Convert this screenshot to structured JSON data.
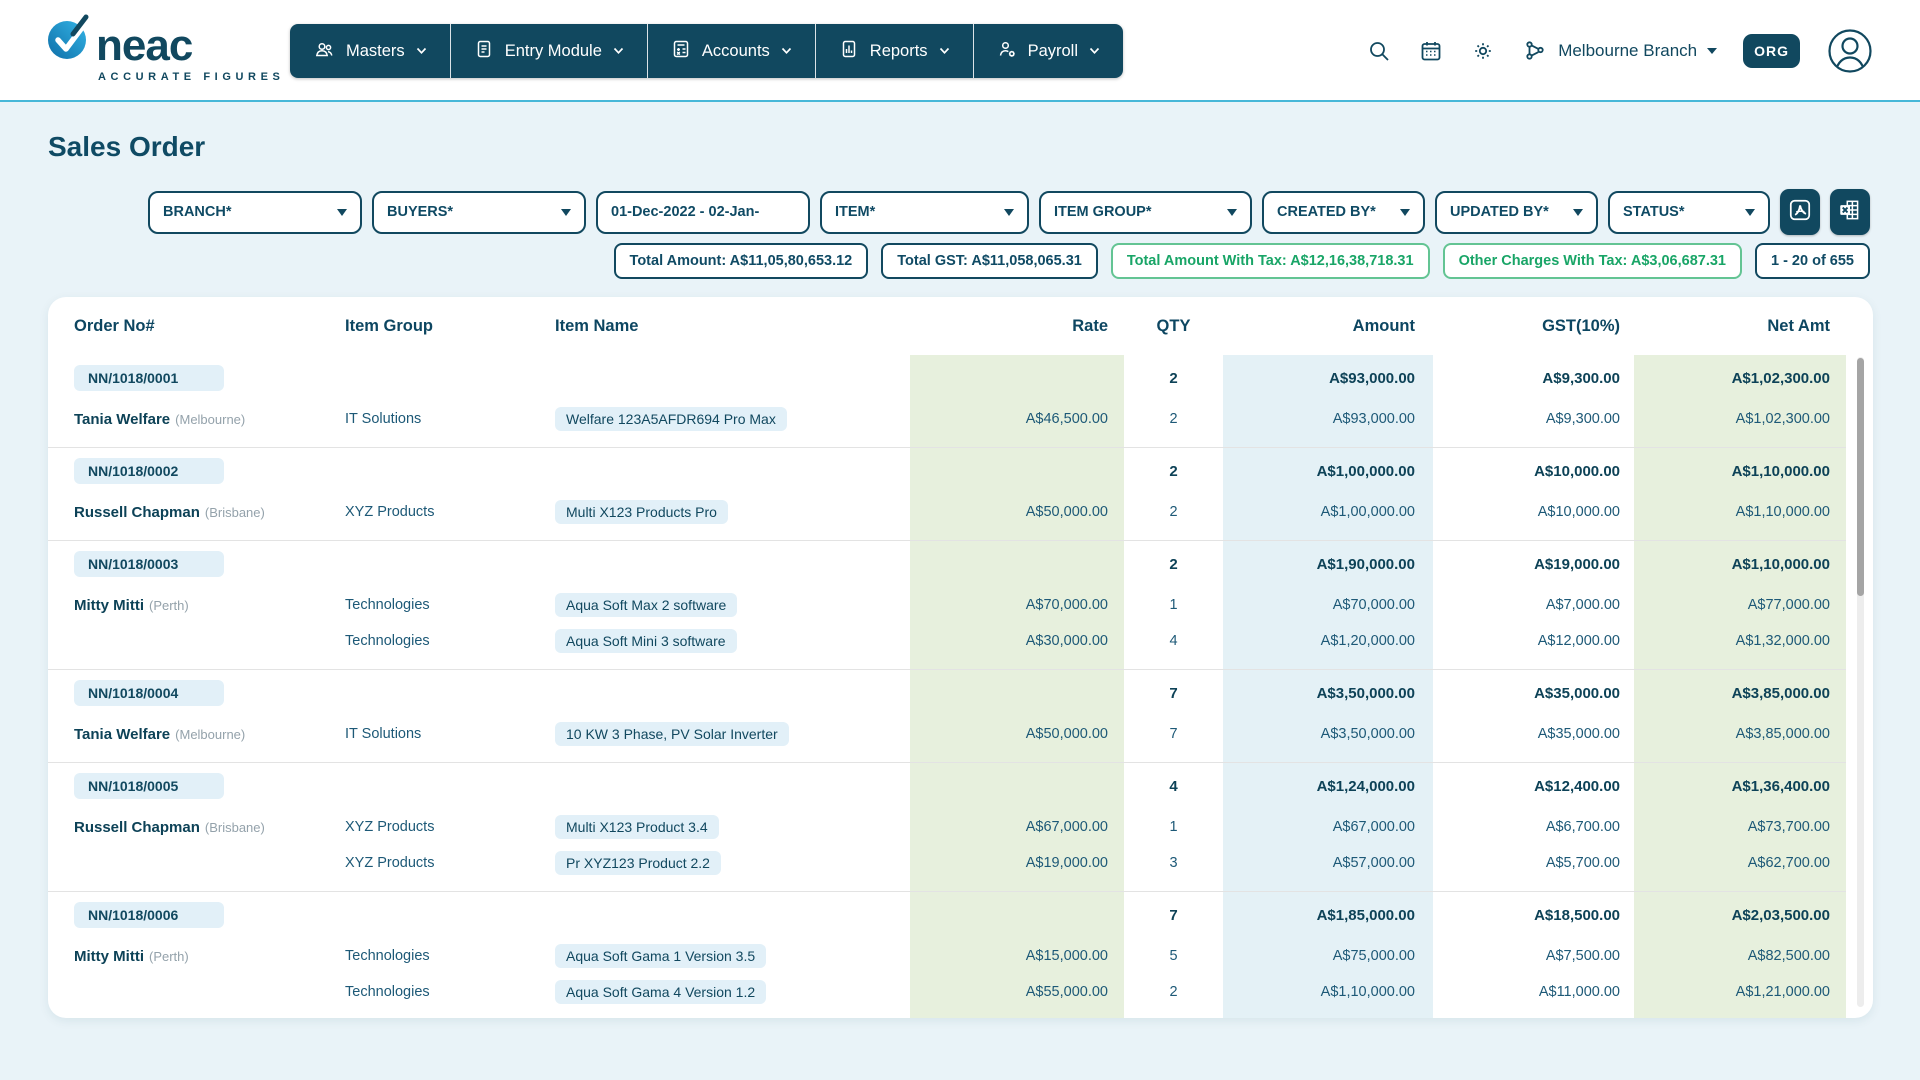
{
  "brand": {
    "name": "neac",
    "tagline": "ACCURATE FIGURES"
  },
  "nav": {
    "items": [
      {
        "label": "Masters",
        "icon": "people-icon"
      },
      {
        "label": "Entry Module",
        "icon": "document-icon"
      },
      {
        "label": "Accounts",
        "icon": "calculator-icon"
      },
      {
        "label": "Reports",
        "icon": "report-icon"
      },
      {
        "label": "Payroll",
        "icon": "payroll-gear-icon"
      }
    ]
  },
  "topbar": {
    "branch": "Melbourne Branch",
    "org_badge": "ORG",
    "icons": [
      "search-icon",
      "calendar-icon",
      "settings-gear-icon",
      "branch-hierarchy-icon",
      "user-avatar-icon"
    ]
  },
  "page_title": "Sales Order",
  "filters": {
    "branch": "BRANCH*",
    "buyers": "BUYERS*",
    "date_range": "01-Dec-2022 - 02-Jan-",
    "item": "ITEM*",
    "item_group": "ITEM GROUP*",
    "created_by": "CREATED BY*",
    "updated_by": "UPDATED BY*",
    "status": "STATUS*"
  },
  "export": {
    "pdf_icon": "pdf-export-icon",
    "excel_icon": "excel-export-icon"
  },
  "summary_badges": {
    "total_amount": "Total Amount: A$11,05,80,653.12",
    "total_gst": "Total GST: A$11,058,065.31",
    "total_with_tax": "Total Amount With Tax: A$12,16,38,718.31",
    "other_charges": "Other Charges With Tax: A$3,06,687.31",
    "pagination": "1 - 20 of 655"
  },
  "colors": {
    "navy": "#11485f",
    "cyan_accent": "#47b7d8",
    "green_text": "#19a567",
    "green_border": "#63c493",
    "band_green": "#e7f0dd",
    "band_blue": "#e4f1f6",
    "pill_blue": "#e2f0f8",
    "page_bg": "#e9f3f8"
  },
  "table": {
    "columns": [
      "Order No#",
      "Item Group",
      "Item Name",
      "Rate",
      "QTY",
      "Amount",
      "GST(10%)",
      "Net Amt"
    ],
    "orders": [
      {
        "order_no": "NN/1018/0001",
        "buyer": "Tania Welfare",
        "buyer_city": "(Melbourne)",
        "summary": {
          "qty": "2",
          "amount": "A$93,000.00",
          "gst": "A$9,300.00",
          "net": "A$1,02,300.00"
        },
        "items": [
          {
            "group": "IT Solutions",
            "name": "Welfare 123A5AFDR694 Pro Max",
            "rate": "A$46,500.00",
            "qty": "2",
            "amount": "A$93,000.00",
            "gst": "A$9,300.00",
            "net": "A$1,02,300.00"
          }
        ]
      },
      {
        "order_no": "NN/1018/0002",
        "buyer": "Russell Chapman",
        "buyer_city": "(Brisbane)",
        "summary": {
          "qty": "2",
          "amount": "A$1,00,000.00",
          "gst": "A$10,000.00",
          "net": "A$1,10,000.00"
        },
        "items": [
          {
            "group": "XYZ Products",
            "name": "Multi X123 Products Pro",
            "rate": "A$50,000.00",
            "qty": "2",
            "amount": "A$1,00,000.00",
            "gst": "A$10,000.00",
            "net": "A$1,10,000.00"
          }
        ]
      },
      {
        "order_no": "NN/1018/0003",
        "buyer": "Mitty Mitti",
        "buyer_city": "(Perth)",
        "summary": {
          "qty": "2",
          "amount": "A$1,90,000.00",
          "gst": "A$19,000.00",
          "net": "A$1,10,000.00"
        },
        "items": [
          {
            "group": "Technologies",
            "name": "Aqua Soft Max 2 software",
            "rate": "A$70,000.00",
            "qty": "1",
            "amount": "A$70,000.00",
            "gst": "A$7,000.00",
            "net": "A$77,000.00"
          },
          {
            "group": "Technologies",
            "name": "Aqua Soft Mini 3 software",
            "rate": "A$30,000.00",
            "qty": "4",
            "amount": "A$1,20,000.00",
            "gst": "A$12,000.00",
            "net": "A$1,32,000.00"
          }
        ]
      },
      {
        "order_no": "NN/1018/0004",
        "buyer": "Tania Welfare",
        "buyer_city": "(Melbourne)",
        "summary": {
          "qty": "7",
          "amount": "A$3,50,000.00",
          "gst": "A$35,000.00",
          "net": "A$3,85,000.00"
        },
        "items": [
          {
            "group": "IT Solutions",
            "name": "10 KW 3 Phase, PV Solar Inverter",
            "rate": "A$50,000.00",
            "qty": "7",
            "amount": "A$3,50,000.00",
            "gst": "A$35,000.00",
            "net": "A$3,85,000.00"
          }
        ]
      },
      {
        "order_no": "NN/1018/0005",
        "buyer": "Russell Chapman",
        "buyer_city": "(Brisbane)",
        "summary": {
          "qty": "4",
          "amount": "A$1,24,000.00",
          "gst": "A$12,400.00",
          "net": "A$1,36,400.00"
        },
        "items": [
          {
            "group": "XYZ Products",
            "name": "Multi X123 Product 3.4",
            "rate": "A$67,000.00",
            "qty": "1",
            "amount": "A$67,000.00",
            "gst": "A$6,700.00",
            "net": "A$73,700.00"
          },
          {
            "group": "XYZ Products",
            "name": "Pr XYZ123 Product 2.2",
            "rate": "A$19,000.00",
            "qty": "3",
            "amount": "A$57,000.00",
            "gst": "A$5,700.00",
            "net": "A$62,700.00"
          }
        ]
      },
      {
        "order_no": "NN/1018/0006",
        "buyer": "Mitty Mitti",
        "buyer_city": "(Perth)",
        "summary": {
          "qty": "7",
          "amount": "A$1,85,000.00",
          "gst": "A$18,500.00",
          "net": "A$2,03,500.00"
        },
        "items": [
          {
            "group": "Technologies",
            "name": "Aqua Soft Gama 1 Version 3.5",
            "rate": "A$15,000.00",
            "qty": "5",
            "amount": "A$75,000.00",
            "gst": "A$7,500.00",
            "net": "A$82,500.00"
          },
          {
            "group": "Technologies",
            "name": "Aqua Soft Gama 4 Version 1.2",
            "rate": "A$55,000.00",
            "qty": "2",
            "amount": "A$1,10,000.00",
            "gst": "A$11,000.00",
            "net": "A$1,21,000.00"
          }
        ]
      }
    ]
  }
}
